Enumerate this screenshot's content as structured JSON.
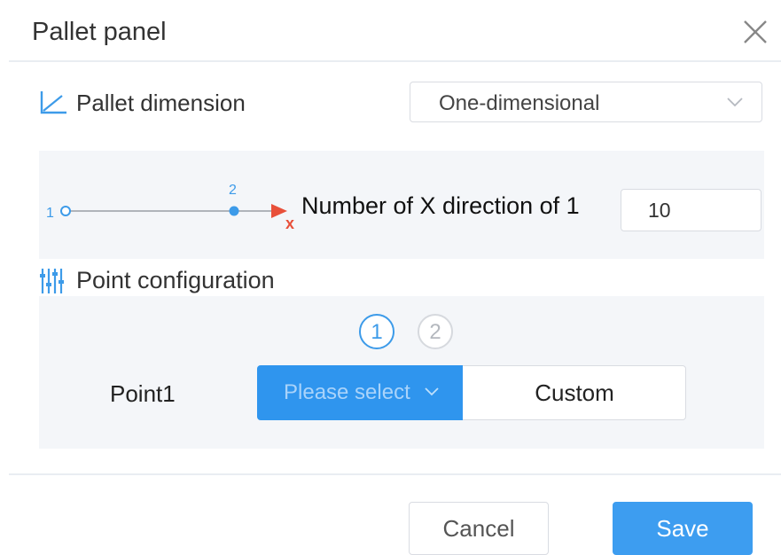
{
  "dialog": {
    "title": "Pallet panel"
  },
  "dimension": {
    "label": "Pallet dimension",
    "selected": "One-dimensional"
  },
  "x_direction": {
    "point_start_label": "1",
    "point_end_label": "2",
    "axis_label": "x",
    "label": "Number of X direction of 1",
    "value": "10"
  },
  "point_config": {
    "label": "Point configuration",
    "steps": [
      "1",
      "2"
    ],
    "active_step": 1,
    "point_label": "Point1",
    "select_placeholder": "Please select",
    "custom_label": "Custom"
  },
  "footer": {
    "cancel_label": "Cancel",
    "save_label": "Save"
  },
  "colors": {
    "accent": "#3d9df0",
    "axis_arrow": "#e8503a",
    "panel_bg": "#f4f6f9"
  }
}
